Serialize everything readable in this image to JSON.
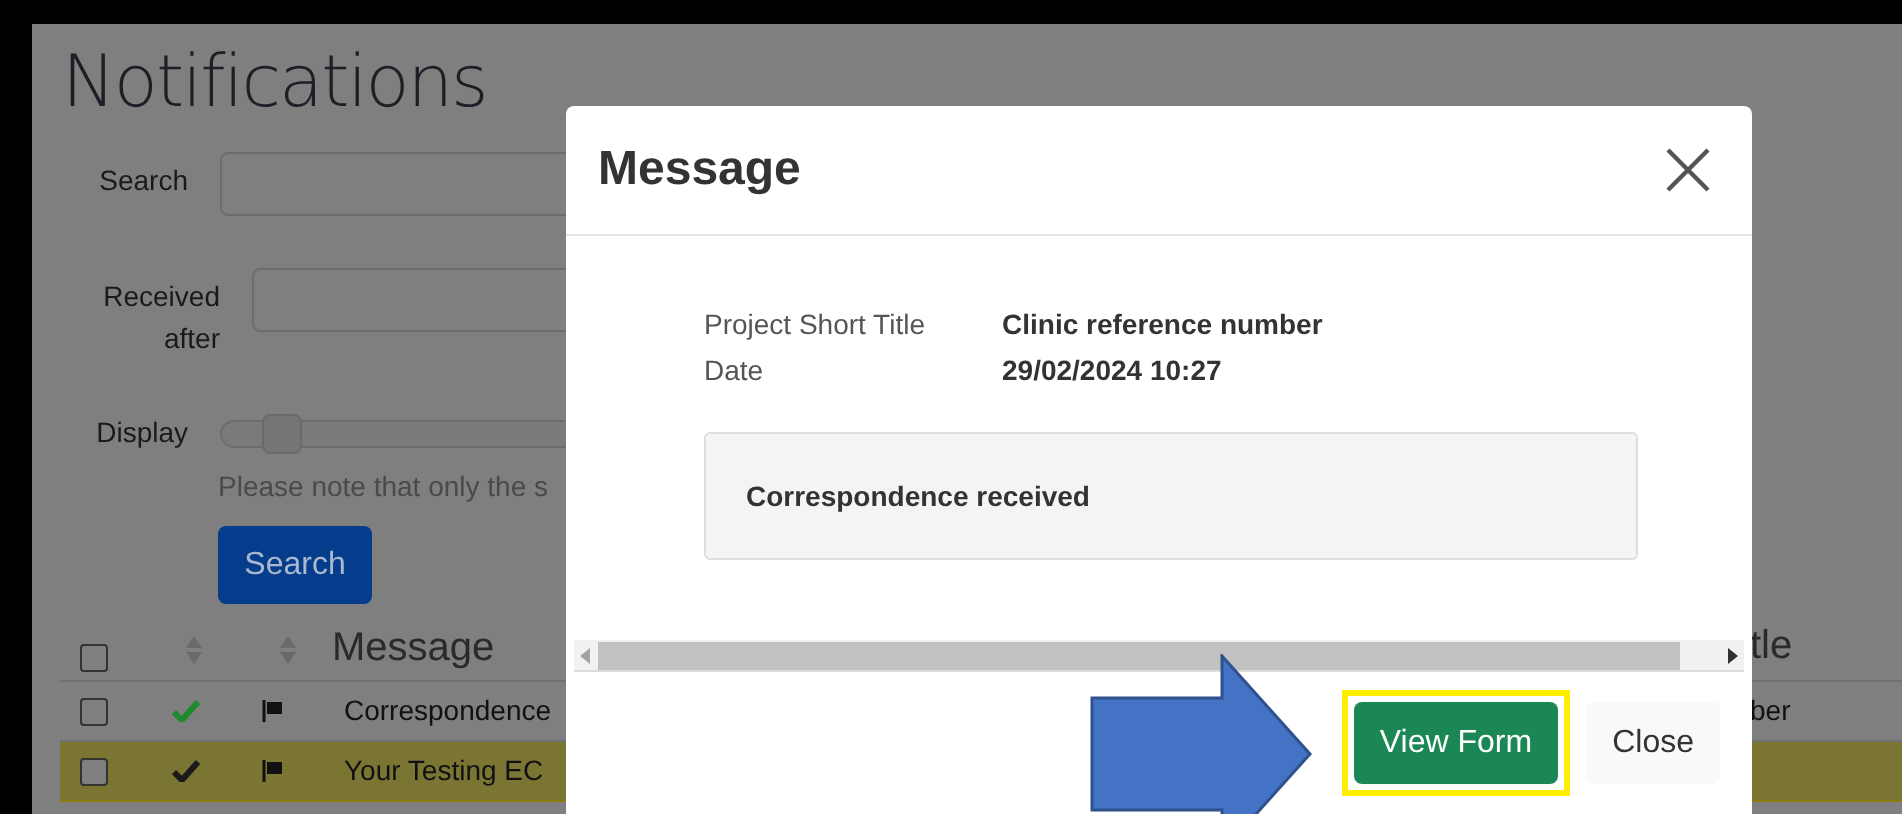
{
  "page": {
    "title": "Notifications",
    "filters": [
      {
        "kind": "text",
        "label": "Search"
      },
      {
        "kind": "text",
        "label": "Received after"
      },
      {
        "kind": "slider",
        "label": "Display",
        "level": 0.05
      }
    ],
    "note": "Please note that only the s",
    "search_button": "Search",
    "table": {
      "columns": [
        {
          "kind": "checkbox",
          "checked": false
        },
        {
          "kind": "sort"
        },
        {
          "kind": "sort"
        },
        {
          "kind": "text",
          "label": "Message"
        },
        {
          "kind": "text",
          "label": "tle"
        }
      ],
      "rows": [
        {
          "checked": false,
          "color": "#1e8a2e",
          "message": "Correspondence",
          "column_5": "ber",
          "highlighted": false
        },
        {
          "checked": false,
          "color": "#1a1a1a",
          "message": "Your Testing EC",
          "column_5": "",
          "highlighted": true
        }
      ]
    }
  },
  "modal": {
    "title": "Message",
    "fields": [
      {
        "label": "Project Short Title",
        "value": "Clinic reference number"
      },
      {
        "label": "Date",
        "value": "29/02/2024 10:27"
      }
    ],
    "message": "Correspondence received",
    "buttons": [
      {
        "label": "View Form",
        "kind": "primary",
        "highlighted": true
      },
      {
        "label": "Close",
        "kind": "secondary",
        "highlighted": false
      }
    ]
  }
}
